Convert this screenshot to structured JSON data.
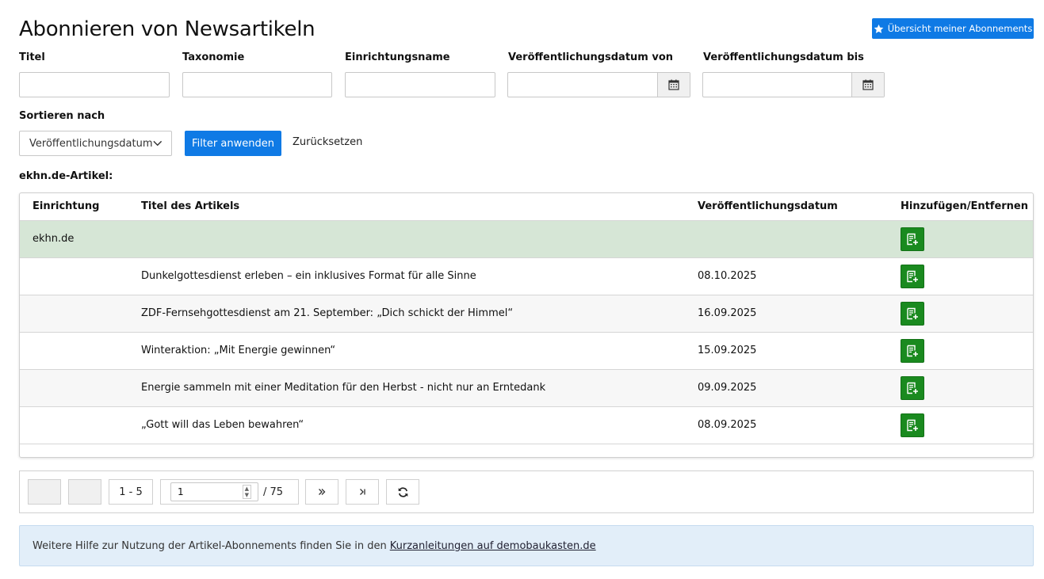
{
  "page": {
    "title": "Abonnieren von Newsartikeln",
    "overview_button": "Übersicht meiner Abonnements"
  },
  "filters": {
    "title_label": "Titel",
    "taxonomy_label": "Taxonomie",
    "org_label": "Einrichtungsname",
    "date_from_label": "Veröffentlichungsdatum von",
    "date_to_label": "Veröffentlichungsdatum bis",
    "title_value": "",
    "taxonomy_value": "",
    "org_value": "",
    "date_from_value": "",
    "date_to_value": ""
  },
  "sort": {
    "label": "Sortieren nach",
    "selected": "Veröffentlichungsdatum",
    "apply_button": "Filter anwenden",
    "reset_link": "Zurücksetzen"
  },
  "section_label": "ekhn.de-Artikel:",
  "table": {
    "headers": {
      "org": "Einrichtung",
      "title": "Titel des Artikels",
      "date": "Veröffentlichungsdatum",
      "action": "Hinzufügen/Entfernen"
    },
    "group": "ekhn.de",
    "rows": [
      {
        "title": "Dunkelgottesdienst erleben – ein inklusives Format für alle Sinne",
        "date": "08.10.2025"
      },
      {
        "title": "ZDF-Fernsehgottesdienst am 21. September: „Dich schickt der Himmel“",
        "date": "16.09.2025"
      },
      {
        "title": "Winteraktion: „Mit Energie gewinnen“",
        "date": "15.09.2025"
      },
      {
        "title": "Energie sammeln mit einer Meditation für den Herbst - nicht nur an Erntedank",
        "date": "09.09.2025"
      },
      {
        "title": "„Gott will das Leben bewahren“",
        "date": "08.09.2025"
      }
    ]
  },
  "pager": {
    "range": "1 - 5",
    "current_page": "1",
    "total_pages": "/ 75"
  },
  "help": {
    "text": "Weitere Hilfe zur Nutzung der Artikel-Abonnements finden Sie in den",
    "link": "Kurzanleitungen auf demobaukasten.de"
  },
  "colors": {
    "primary": "#0f7ae5",
    "add_green": "#1a8a1f",
    "group_row": "#d6e6d6",
    "help_bg": "#e2eef9"
  },
  "icons": {
    "overview": "star-icon",
    "calendar": "calendar-icon",
    "select": "chevron-down-icon",
    "add": "add-to-list-icon",
    "next": "double-chevron-right-icon",
    "last": "skip-to-end-icon",
    "refresh": "refresh-icon"
  }
}
